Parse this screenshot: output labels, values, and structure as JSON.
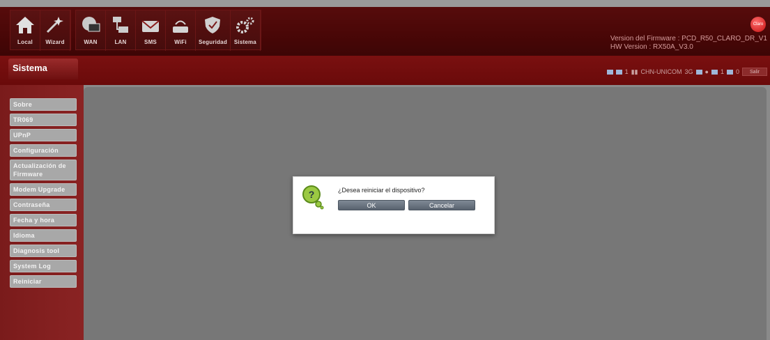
{
  "nav": {
    "items": [
      {
        "label": "Local",
        "icon": "home-icon"
      },
      {
        "label": "Wizard",
        "icon": "wizard-icon"
      },
      {
        "label": "WAN",
        "icon": "globe-monitor-icon"
      },
      {
        "label": "LAN",
        "icon": "network-icon"
      },
      {
        "label": "SMS",
        "icon": "envelope-icon"
      },
      {
        "label": "WiFi",
        "icon": "wifi-router-icon"
      },
      {
        "label": "Seguridad",
        "icon": "shield-icon"
      },
      {
        "label": "Sistema",
        "icon": "gears-icon"
      }
    ]
  },
  "firmware": {
    "version": "Version del Firmware : PCD_R50_CLARO_DR_V1",
    "hw": "HW Version : RX50A_V3.0"
  },
  "logo_text": "Claro",
  "section_title": "Sistema",
  "status": {
    "sms_count": "1",
    "network": "CHN-UNICOM",
    "tech": "3G",
    "msg1": "1",
    "msg2": "0",
    "logout": "Salir"
  },
  "sidebar": {
    "items": [
      "Sobre",
      "TR069",
      "UPnP",
      "Configuración",
      "Actualización de Firmware",
      "Modem Upgrade",
      "Contraseña",
      "Fecha y hora",
      "Idioma",
      "Diagnosis tool",
      "System Log",
      "Reiniciar"
    ]
  },
  "dialog": {
    "message": "¿Desea reiniciar el dispositivo?",
    "ok_label": "OK",
    "cancel_label": "Cancelar"
  },
  "colors": {
    "header": "#4a0707",
    "subbar": "#6a0a0a",
    "sidebar": "#7a1b1b",
    "overlay": "#777777",
    "button": "#65707c"
  }
}
